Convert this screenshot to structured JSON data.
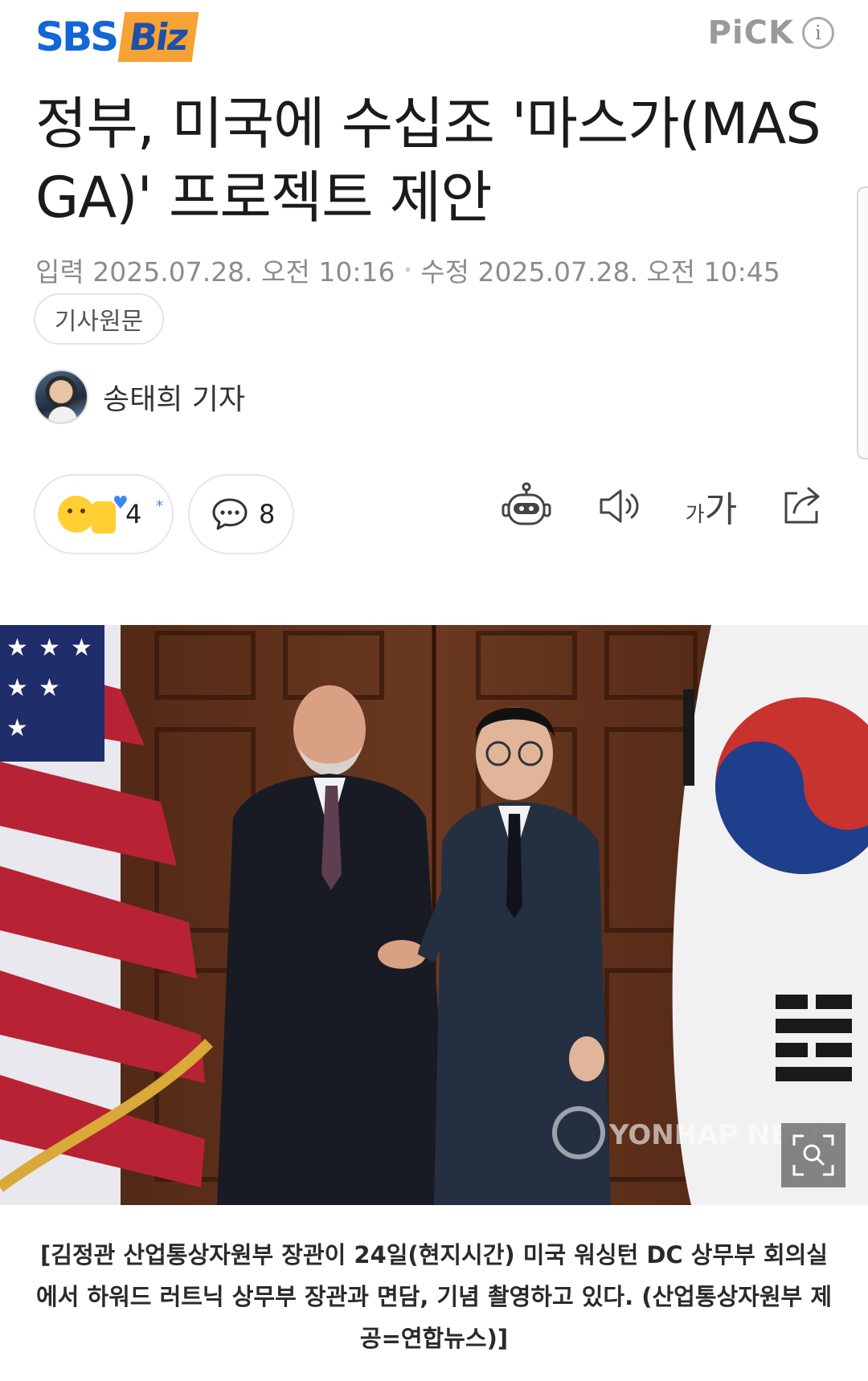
{
  "header": {
    "logo_sbs": "SBS",
    "logo_biz": "Biz",
    "pick_label": "PiCK",
    "info_label": "i"
  },
  "article": {
    "title": "정부, 미국에 수십조 '마스가(MASGA)' 프로젝트 제안",
    "input_label": "입력",
    "input_date": "2025.07.28. 오전 10:16",
    "modified_label": "수정",
    "modified_date": "2025.07.28. 오전 10:45",
    "original_button": "기사원문",
    "reporter": "송태희 기자",
    "caption": "[김정관 산업통상자원부 장관이 24일(현지시간) 미국 워싱턴 DC 상무부 회의실에서 하워드 러트닉 상무부 장관과 면담, 기념 촬영하고 있다. (산업통상자원부 제공=연합뉴스)]",
    "watermark": "YONHAP NEWS"
  },
  "actions": {
    "reaction_count": "4",
    "comment_count": "8",
    "font_small": "가",
    "font_large": "가",
    "icons": [
      "robot-summary-icon",
      "speaker-icon",
      "font-size-icon",
      "share-icon"
    ]
  },
  "colors": {
    "sbs_blue": "#1366d6",
    "biz_orange": "#f7a234",
    "meta_gray": "#8c8c8c"
  }
}
